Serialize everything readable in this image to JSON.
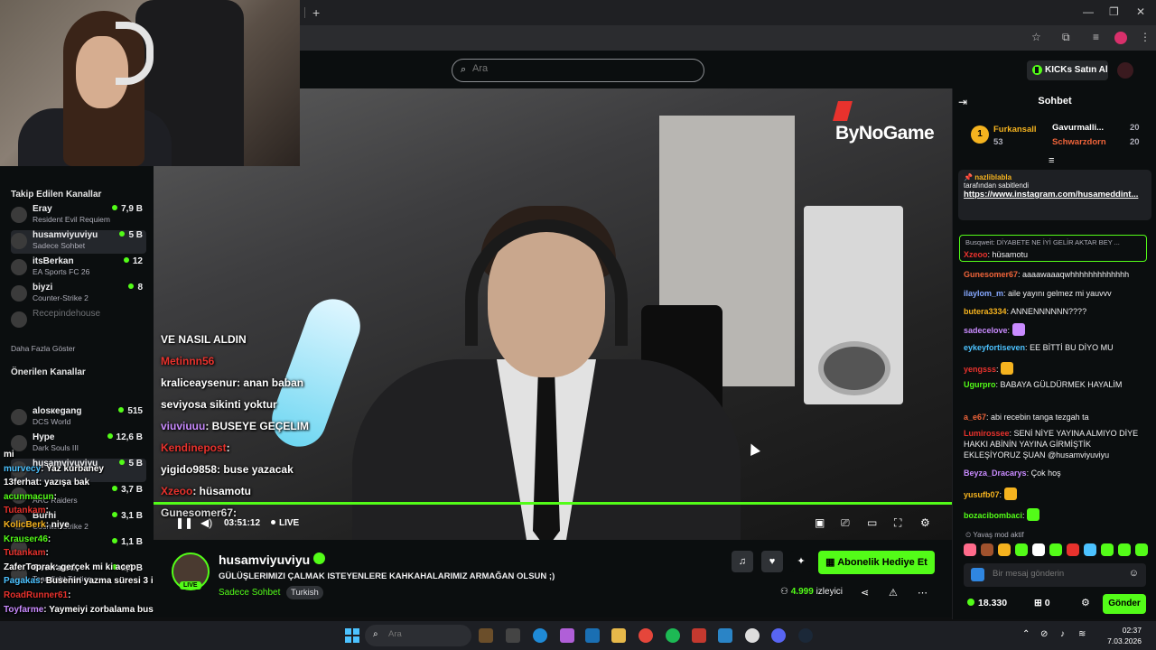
{
  "browser": {
    "new_tab": "+",
    "minimize": "—",
    "restore": "❐",
    "close": "✕"
  },
  "header": {
    "search_placeholder": "Ara",
    "kicks_label": "KICKs Satın Al"
  },
  "watermark": "ByNoGame",
  "sidebar": {
    "followed_title": "Takip Edilen Kanallar",
    "followed": [
      {
        "name": "Eray",
        "category": "Resident Evil Requiem",
        "viewers": "7,9 B",
        "live": true
      },
      {
        "name": "husamviyuviyu",
        "category": "Sadece Sohbet",
        "viewers": "5 B",
        "live": true
      },
      {
        "name": "itsBerkan",
        "category": "EA Sports FC 26",
        "viewers": "12",
        "live": true
      },
      {
        "name": "biyzi",
        "category": "Counter-Strike 2",
        "viewers": "8",
        "live": true
      },
      {
        "name": "Recepindehouse",
        "category": "",
        "viewers": "",
        "live": false
      }
    ],
    "more_label": "Daha Fazla Göster",
    "recommended_title": "Önerilen Kanallar",
    "recommended": [
      {
        "name": "alosкegang",
        "category": "DCS World",
        "viewers": "515"
      },
      {
        "name": "Hype",
        "category": "Dark Souls III",
        "viewers": "12,6 B"
      },
      {
        "name": "husamviyuviyu",
        "category": "",
        "viewers": "5 B"
      },
      {
        "name": "",
        "category": "ARC Raiders",
        "viewers": "3,7 B"
      },
      {
        "name": "Burhi",
        "category": "Counter-Strike 2",
        "viewers": "3,1 B"
      },
      {
        "name": "",
        "category": "",
        "viewers": "1,1 B"
      },
      {
        "name": "Overrated",
        "category": "Teamfight Tactics",
        "viewers": "1,1 B"
      }
    ]
  },
  "overlay_chat": [
    {
      "user": "",
      "text": "VE NASIL ALDIN",
      "color": "#ffffff"
    },
    {
      "user": "Metinnn56",
      "text": "",
      "color": "#e8322d"
    },
    {
      "user": "kraliceaysenur",
      "text": ": anan baban",
      "color": "#ffffff"
    },
    {
      "user": "",
      "text": "seviyosa sikinti yoktur",
      "color": "#ffffff"
    },
    {
      "user": "viuviuuu",
      "text": ": BUSEYE GEÇELIM",
      "color": "#c98bff"
    },
    {
      "user": "Kendinepost",
      "text": ":",
      "color": "#e8322d"
    },
    {
      "user": "yigido9858",
      "text": ": buse yazacak",
      "color": "#ffffff"
    },
    {
      "user": "Xzeoo",
      "text": ": hüsamotu",
      "color": "#e8322d"
    },
    {
      "user": "Gunesomer67",
      "text": ":",
      "color": "#d9d9d9"
    }
  ],
  "left_overlay": [
    {
      "user": "mi",
      "text": "",
      "color": "#ffffff"
    },
    {
      "user": "murvecy",
      "text": ": Yaz kurbaney",
      "color": "#4cc2ff"
    },
    {
      "user": "13ferhat",
      "text": ": yazışa bak",
      "color": "#ffffff"
    },
    {
      "user": "acunmacun",
      "text": ":",
      "color": "#53fc18"
    },
    {
      "user": "Tutankam",
      "text": ":",
      "color": "#e8322d"
    },
    {
      "user": "KolicBerk",
      "text": ": niye",
      "color": "#f5b31f"
    },
    {
      "user": "Krauser46",
      "text": ":",
      "color": "#53fc18"
    },
    {
      "user": "Tutankam",
      "text": ":",
      "color": "#e8322d"
    },
    {
      "user": "ZaferToprak",
      "text": ": gerçek mi ki acep",
      "color": "#ffffff"
    },
    {
      "user": "Pagakas",
      "text": ": Busenin yazma süresi 3 iş günü",
      "color": "#4cc2ff"
    },
    {
      "user": "RoadRunner61",
      "text": ":",
      "color": "#e8322d"
    },
    {
      "user": "Toyfarme",
      "text": ": Yaymeiyi zorbalama buse yakışmadı sana",
      "color": "#c98bff"
    }
  ],
  "player": {
    "time": "03:51:12",
    "live": "LIVE"
  },
  "stream": {
    "channel": "husamviyuviyu",
    "title": "GÜLÜŞLERIMIZI ÇALMAK ISTEYENLERE KAHKAHALARIMIZ ARMAĞAN OLSUN ;)",
    "category": "Sadece Sohbet",
    "language": "Turkish",
    "live_badge": "LIVE",
    "gift_label": "Abonelik Hediye Et",
    "viewer_count": "4.999",
    "viewer_label": "izleyici"
  },
  "chat": {
    "title": "Sohbet",
    "leaderboard": [
      {
        "name": "Furkansall",
        "value": "53",
        "rank": "1"
      },
      {
        "name": "Gavurmalli...",
        "value": "20"
      },
      {
        "name": "Schwarzdorn",
        "value": "20"
      }
    ],
    "pinned": {
      "user": "nazliblabla",
      "by_text": "tarafından sabitlendi",
      "link": "https://www.instagram.com/husameddint..."
    },
    "reply_preview": "Busqweit: DİYABETE NE İYİ GELİR AKTAR BEY ...",
    "messages": [
      {
        "user": "Xzeoo",
        "text": "hüsamotu",
        "color": "#e8322d"
      },
      {
        "user": "Gunesomer67",
        "text": "aaaawaaaqwhhhhhhhhhhhhh",
        "color": "#f0643a"
      },
      {
        "user": "ilaylom_m",
        "text": "aile yayını gelmez mi yauvvv",
        "color": "#86a8ff"
      },
      {
        "user": "butera3334",
        "text": "ANNENNNNNN????",
        "color": "#f5b31f"
      },
      {
        "user": "sadecelove",
        "text": "",
        "color": "#c98bff"
      },
      {
        "user": "eykeyfortiseven",
        "text": "EE BİTTİ BU DİYO MU",
        "color": "#4cc2ff"
      },
      {
        "user": "yengsss",
        "text": "",
        "color": "#e8322d"
      },
      {
        "user": "Ugurpro",
        "text": "BABAYA GÜLDÜRMEK HAYALİM",
        "color": "#53fc18"
      },
      {
        "user": "a_e67",
        "text": "abi recebin tanga tezgah ta",
        "color": "#f0643a"
      },
      {
        "user": "Lumirossee",
        "text": "SENİ NİYE YAYINA ALMIYO DİYE HAKKI ABİNİN YAYINA GİRMİŞTİK EKLEŞİYORUZ ŞUAN @husamviyuviyu",
        "color": "#e8322d"
      },
      {
        "user": "Beyza_Dracarys",
        "text": "Çok hoş",
        "color": "#c98bff"
      },
      {
        "user": "yusufb07",
        "text": "",
        "color": "#f5b31f"
      },
      {
        "user": "bozacibombaci",
        "text": "",
        "color": "#53fc18"
      }
    ],
    "slow_mode": "Yavaş mod aktif",
    "input_placeholder": "Bir mesaj gönderin",
    "points": "18.330",
    "drops": "0",
    "send_label": "Gönder"
  },
  "taskbar": {
    "search_placeholder": "Ara",
    "time": "02:37",
    "date": "7.03.2026"
  },
  "colors": {
    "accent": "#53fc18",
    "bg": "#0b0e0f"
  }
}
